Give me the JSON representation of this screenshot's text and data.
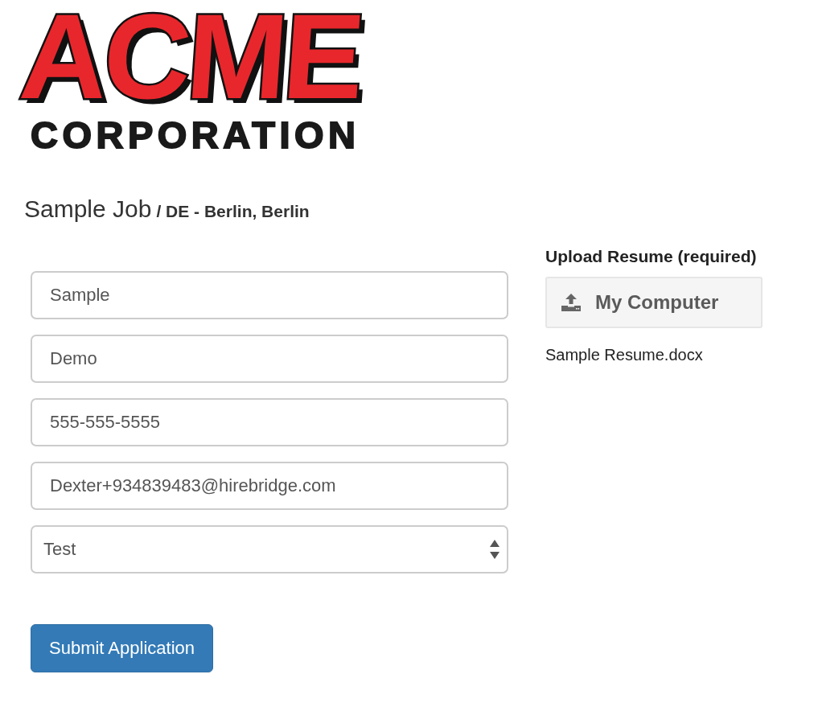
{
  "logo": {
    "title": "ACME",
    "subtitle": "CORPORATION"
  },
  "job": {
    "title": "Sample Job",
    "location": "/ DE - Berlin, Berlin"
  },
  "form": {
    "fields": [
      {
        "kind": "text",
        "value": "Sample"
      },
      {
        "kind": "text",
        "value": "Demo"
      },
      {
        "kind": "text",
        "value": "555-555-5555"
      },
      {
        "kind": "text",
        "value": "Dexter+934839483@hirebridge.com"
      },
      {
        "kind": "select",
        "value": "Test"
      }
    ],
    "submit_button": "Submit Application"
  },
  "upload": {
    "label": "Upload Resume (required)",
    "button": "My Computer",
    "file_name": "Sample Resume.docx"
  }
}
